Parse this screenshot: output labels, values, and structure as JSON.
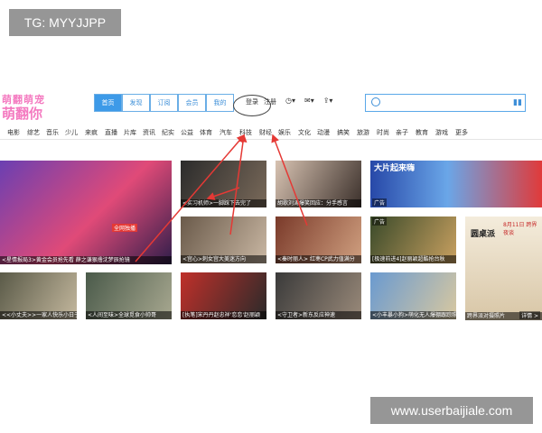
{
  "watermarks": {
    "top_left": "TG: MYYJJPP",
    "bottom_right": "www.userbaijiale.com"
  },
  "logo": {
    "line1": "萌翻萌宠",
    "line2": "萌翻你"
  },
  "header": {
    "tabs": [
      "首页",
      "发现",
      "订阅",
      "会员",
      "我的"
    ],
    "login": "登录",
    "register": "注册",
    "icons": [
      "clock-icon",
      "mail-icon",
      "upload-icon"
    ],
    "search": {
      "placeholder": ""
    },
    "accent": "#3d9ae8"
  },
  "nav": {
    "items": [
      "首页",
      "电影",
      "综艺",
      "音乐",
      "少儿",
      "来疯",
      "直播",
      "片库",
      "资讯",
      "纪实",
      "公益",
      "体育",
      "汽车",
      "科技",
      "财经",
      "娱乐",
      "文化",
      "动漫",
      "搞笑",
      "旅游",
      "时尚",
      "亲子",
      "教育",
      "游戏",
      "更多"
    ]
  },
  "videos": [
    {
      "caption": "<星情报局3>黄金会员抢先看 薛之谦狠撸沈梦辰抢镜",
      "badge": "全网独播"
    },
    {
      "caption": "<实习机师>一脚踩下去完了",
      "badge": ""
    },
    {
      "caption": "胡歌刘涛爆笑回应：分手感言",
      "badge": ""
    },
    {
      "caption": "大片起来嗨",
      "badge": "广告"
    },
    {
      "caption": "<宫心>刺女宫大美迷方向",
      "badge": ""
    },
    {
      "caption": "<秦时丽人> 红枣CP武力值满分",
      "badge": ""
    },
    {
      "caption": "[极速前进4]赵丽颖超酷抢台秋",
      "badge": "广告"
    },
    {
      "caption": "圆桌派",
      "badge": "8月11日 跨界夜谈"
    },
    {
      "caption": "<<小丈夫>>一家人快乐小日子",
      "badge": ""
    },
    {
      "caption": "<人间至味>全球觅食小帅哥",
      "badge": ""
    },
    {
      "caption": "[执笔]宋丹丹赵忠祥'恋恋'赵丽颖",
      "badge": ""
    },
    {
      "caption": "<守卫者>新东反应神速",
      "badge": ""
    },
    {
      "caption": "<小丰暴小狗>萌化无人爆棚跟踪照",
      "badge": ""
    },
    {
      "caption": "跨界派对摄照片",
      "badge": "详情 >"
    }
  ]
}
